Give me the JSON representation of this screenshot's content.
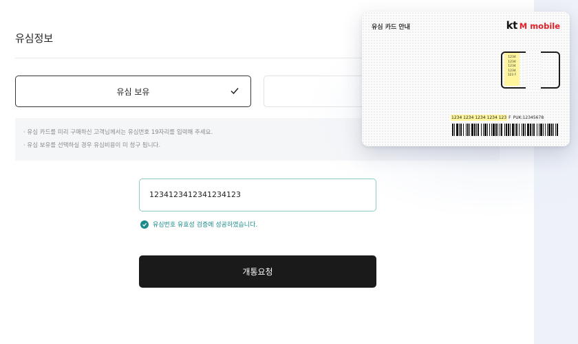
{
  "section": {
    "title": "유심정보"
  },
  "sim_options": [
    {
      "label": "유심 보유",
      "selected": true
    },
    {
      "label": "",
      "selected": false
    }
  ],
  "notice": {
    "lines": [
      "유심 카드를 미리 구매하신 고객님께서는 유심번호 19자리를 입력해 주세요.",
      "유심 보유를 선택하실 경우 유심비용이 미 청구 됩니다."
    ]
  },
  "usim_input": {
    "value": "1234123412341234123"
  },
  "validation": {
    "message": "유심번호 유효성 검증에 성공하였습니다.",
    "icon": "check-circle-icon"
  },
  "submit": {
    "label": "개통요청"
  },
  "sim_card_guide": {
    "title": "유심 카드 안내",
    "brand_kt": "kt",
    "brand_rest": "M mobile",
    "chip_numbers": [
      "1234",
      "1234",
      "1234",
      "1234",
      "123 F"
    ],
    "serial": "1234 1234 1234 1234 123",
    "serial_suffix": "F",
    "puk": "PUK:12345678"
  },
  "colors": {
    "accent_teal": "#1b8a8a",
    "button_dark": "#1a1a1a",
    "brand_red": "#e41e26",
    "highlight_yellow": "#fff59d"
  }
}
